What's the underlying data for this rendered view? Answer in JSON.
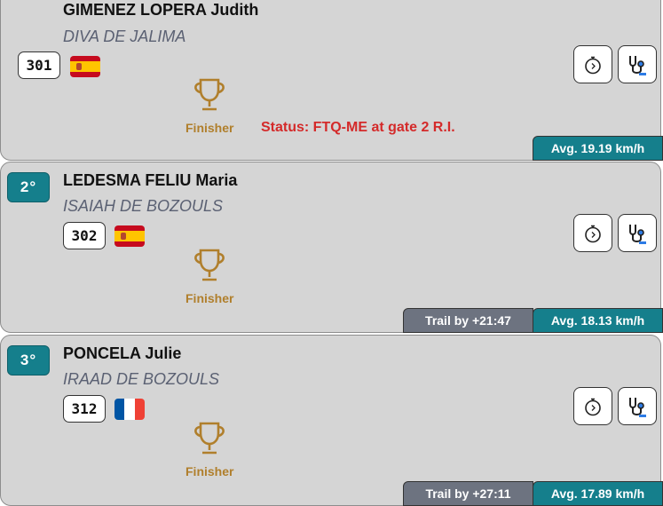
{
  "entries": [
    {
      "rank": "",
      "rider": "GIMENEZ LOPERA Judith",
      "horse": "DIVA DE JALIMA",
      "bib": "301",
      "flag": "spain-flag",
      "status_word": "Finisher",
      "status_detail": "Status: FTQ-ME at gate 2 R.I.",
      "trail": "",
      "avg": "Avg. 19.19 km/h"
    },
    {
      "rank": "2°",
      "rider": "LEDESMA FELIU Maria",
      "horse": "ISAIAH DE BOZOULS",
      "bib": "302",
      "flag": "spain-flag",
      "status_word": "Finisher",
      "status_detail": "",
      "trail": "Trail by +21:47",
      "avg": "Avg. 18.13 km/h"
    },
    {
      "rank": "3°",
      "rider": "PONCELA Julie",
      "horse": "IRAAD DE BOZOULS",
      "bib": "312",
      "flag": "france-flag",
      "status_word": "Finisher",
      "status_detail": "",
      "trail": "Trail by +27:11",
      "avg": "Avg. 17.89 km/h"
    }
  ],
  "icons": {
    "timer": "stopwatch-icon",
    "vet": "stethoscope-icon",
    "trophy": "trophy-icon"
  },
  "colors": {
    "card_bg": "#d5d5d5",
    "teal": "#157f8c",
    "grey_tag": "#6d7380",
    "finisher_gold": "#b07f2c",
    "status_red": "#d42a2a"
  }
}
